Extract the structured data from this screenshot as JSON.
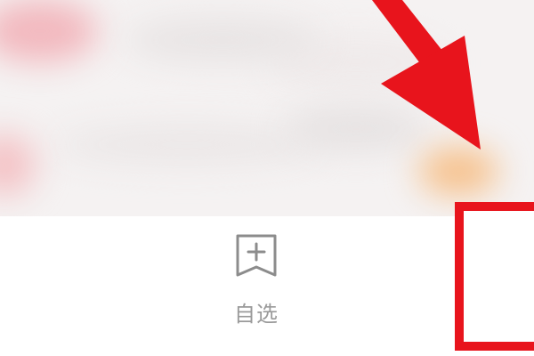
{
  "tab_bar": {
    "watchlist_tab": {
      "label": "自选",
      "icon": "bookmark-plus-icon"
    }
  },
  "annotation": {
    "arrow_color": "#e8141c",
    "highlight_color": "#e8141c"
  },
  "colors": {
    "tab_label": "#9a9a9a",
    "tab_icon": "#8c8c8c",
    "background": "#ffffff"
  }
}
